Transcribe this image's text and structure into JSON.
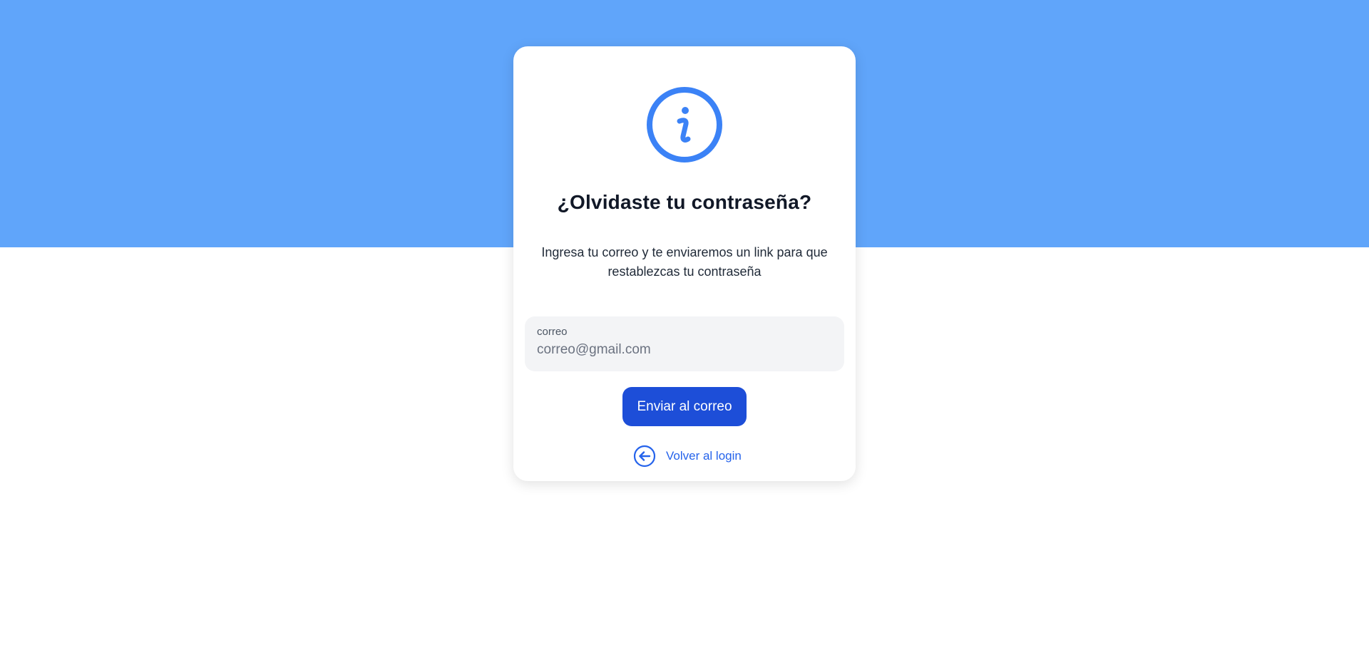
{
  "colors": {
    "top_band": "#60a5fa",
    "icon_blue": "#3b82f6",
    "button_blue": "#1d4ed8",
    "link_blue": "#2563eb"
  },
  "card": {
    "icon": "info-circle-icon",
    "title": "¿Olvidaste tu contraseña?",
    "subtitle_line1": "Ingresa tu correo y te enviaremos un link para que",
    "subtitle_line2": "restablezcas tu contraseña"
  },
  "form": {
    "email_label": "correo",
    "email_value": "",
    "email_placeholder": "correo@gmail.com",
    "submit_label": "Enviar al correo"
  },
  "back_link": {
    "icon": "arrow-left-circle-icon",
    "label": "Volver al login"
  }
}
